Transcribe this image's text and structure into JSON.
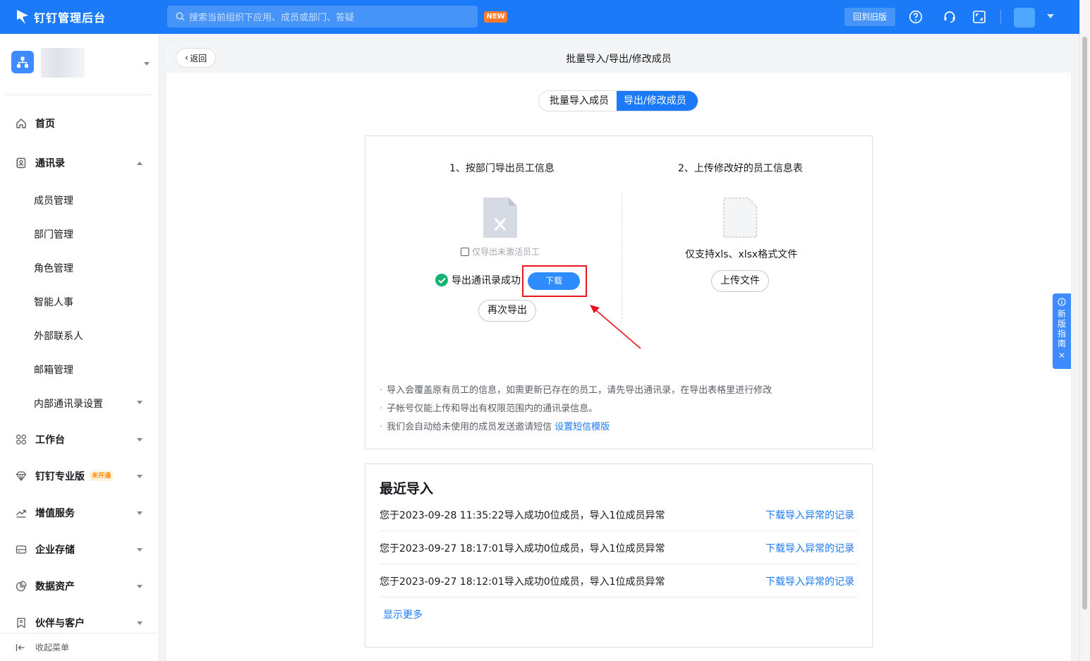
{
  "topbar": {
    "app_title": "钉钉管理后台",
    "search_placeholder": "搜索当前组织下应用、成员或部门、答疑",
    "new_badge": "NEW",
    "back_old_label": "回到旧版",
    "icons": [
      "help-icon",
      "headset-icon",
      "fullscreen-icon"
    ],
    "brand_color": "#1a7af8"
  },
  "sidebar": {
    "nav": [
      {
        "label": "首页",
        "icon": "home-icon"
      },
      {
        "label": "通讯录",
        "icon": "contacts-icon",
        "expanded": true
      },
      {
        "label": "工作台",
        "icon": "apps-icon"
      },
      {
        "label": "钉钉专业版",
        "icon": "diamond-icon",
        "badge": "未开通"
      },
      {
        "label": "增值服务",
        "icon": "trend-icon"
      },
      {
        "label": "企业存储",
        "icon": "storage-icon"
      },
      {
        "label": "数据资产",
        "icon": "pie-icon"
      },
      {
        "label": "伙伴与客户",
        "icon": "bookmark-icon"
      }
    ],
    "sub_items": [
      "成员管理",
      "部门管理",
      "角色管理",
      "智能人事",
      "外部联系人",
      "邮箱管理",
      "内部通讯录设置"
    ],
    "collapse_label": "收起菜单"
  },
  "main": {
    "back_label": "返回",
    "page_title": "批量导入/导出/修改成员",
    "tabs": [
      {
        "label": "批量导入成员",
        "active": false
      },
      {
        "label": "导出/修改成员",
        "active": true
      }
    ],
    "step1": {
      "title": "1、按部门导出员工信息",
      "checkbox_label": "仅导出未激活员工",
      "success_text": "导出通讯录成功",
      "download_label": "下载",
      "reexport_label": "再次导出"
    },
    "step2": {
      "title": "2、上传修改好的员工信息表",
      "support_text": "仅支持xls、xlsx格式文件",
      "upload_label": "上传文件"
    },
    "notes": [
      "导入会覆盖原有员工的信息，如需更新已存在的员工，请先导出通讯录，在导出表格里进行修改",
      "子帐号仅能上传和导出有权限范围内的通讯录信息。",
      "我们会自动给未使用的成员发送邀请短信"
    ],
    "notes_link": "设置短信模版",
    "recent": {
      "title": "最近导入",
      "rows": [
        {
          "text": "您于2023-09-28 11:35:22导入成功0位成员，导入1位成员异常",
          "link": "下载导入异常的记录"
        },
        {
          "text": "您于2023-09-27 18:17:01导入成功0位成员，导入1位成员异常",
          "link": "下载导入异常的记录"
        },
        {
          "text": "您于2023-09-27 18:12:01导入成功0位成员，导入1位成员异常",
          "link": "下载导入异常的记录"
        }
      ],
      "more_label": "显示更多"
    }
  },
  "guide": {
    "label": "新版指南"
  }
}
